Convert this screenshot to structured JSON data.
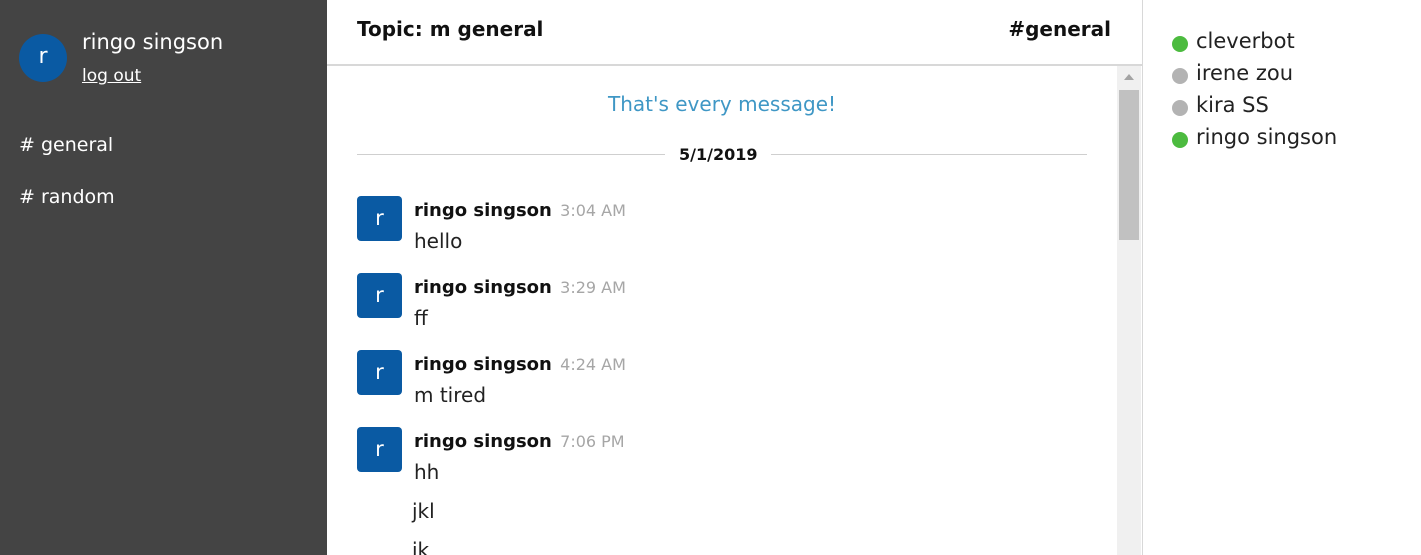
{
  "sidebar": {
    "avatar_initial": "r",
    "user_name": "ringo singson",
    "logout_label": "log out",
    "channels": [
      {
        "label": "# general"
      },
      {
        "label": "# random"
      }
    ]
  },
  "header": {
    "topic": "Topic: m general",
    "channel": "#general"
  },
  "messages": {
    "end_notice": "That's every message!",
    "date": "5/1/2019",
    "items": [
      {
        "avatar_initial": "r",
        "author": "ringo singson",
        "time": "3:04 AM",
        "lines": [
          "hello"
        ]
      },
      {
        "avatar_initial": "r",
        "author": "ringo singson",
        "time": "3:29 AM",
        "lines": [
          "ff"
        ]
      },
      {
        "avatar_initial": "r",
        "author": "ringo singson",
        "time": "4:24 AM",
        "lines": [
          "m tired"
        ]
      },
      {
        "avatar_initial": "r",
        "author": "ringo singson",
        "time": "7:06 PM",
        "lines": [
          "hh",
          "jkl",
          "jk"
        ]
      }
    ]
  },
  "users": [
    {
      "name": "cleverbot",
      "status": "online"
    },
    {
      "name": "irene zou",
      "status": "offline"
    },
    {
      "name": "kira SS",
      "status": "offline"
    },
    {
      "name": "ringo singson",
      "status": "online"
    }
  ],
  "colors": {
    "sidebar_bg": "#444444",
    "avatar_blue": "#0a5aa3",
    "online": "#4cbb3f",
    "offline": "#b3b3b3",
    "notice": "#3f97c5"
  }
}
